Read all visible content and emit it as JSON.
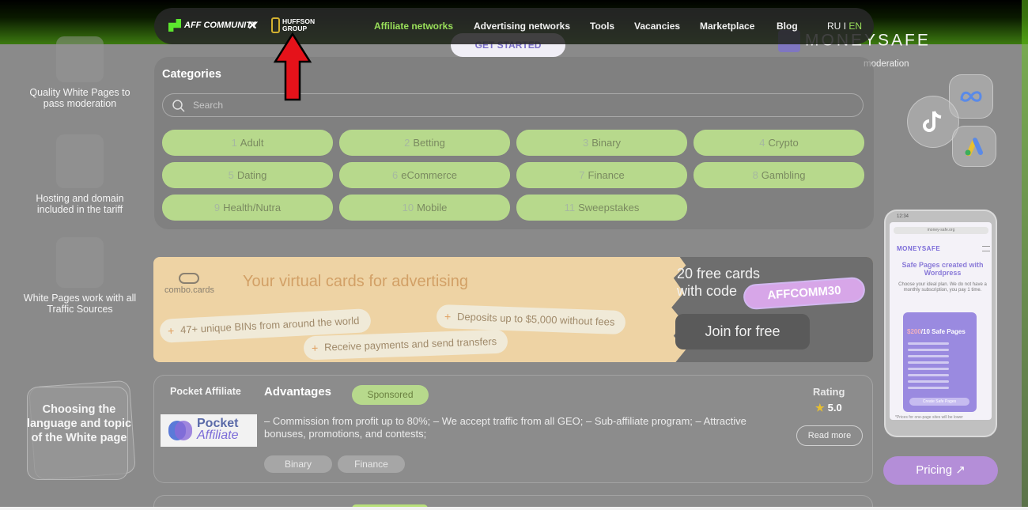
{
  "nav": {
    "brand_aff": "AFF COMMUNITY",
    "brand_x": "✕",
    "brand_huffson_line1": "HUFFSON",
    "brand_huffson_line2": "GROUP",
    "items": [
      {
        "label": "Affiliate networks",
        "active": true
      },
      {
        "label": "Advertising networks",
        "active": false
      },
      {
        "label": "Tools",
        "active": false
      },
      {
        "label": "Vacancies",
        "active": false
      },
      {
        "label": "Marketplace",
        "active": false
      },
      {
        "label": "Blog",
        "active": false
      }
    ],
    "lang_ru": "RU",
    "lang_sep": "I",
    "lang_en": "EN"
  },
  "hero": {
    "cta_partial": "GET STARTED",
    "ms_logo": "MONEYSAFE",
    "ms_sub": "moderation"
  },
  "features": [
    {
      "text": "Quality White Pages to pass moderation"
    },
    {
      "text": "Hosting and domain included in the tariff"
    },
    {
      "text": "White Pages work with all Traffic Sources"
    },
    {
      "text": "Choosing the language and topic of the White page"
    }
  ],
  "categories": {
    "title": "Categories",
    "search_placeholder": "Search",
    "items": [
      {
        "num": "1",
        "label": "Adult"
      },
      {
        "num": "2",
        "label": "Betting"
      },
      {
        "num": "3",
        "label": "Binary"
      },
      {
        "num": "4",
        "label": "Crypto"
      },
      {
        "num": "5",
        "label": "Dating"
      },
      {
        "num": "6",
        "label": "eCommerce"
      },
      {
        "num": "7",
        "label": "Finance"
      },
      {
        "num": "8",
        "label": "Gambling"
      },
      {
        "num": "9",
        "label": "Health/Nutra"
      },
      {
        "num": "10",
        "label": "Mobile"
      },
      {
        "num": "11",
        "label": "Sweepstakes"
      }
    ]
  },
  "banner": {
    "logo": "combo.cards",
    "headline": "Your virtual cards for advertising",
    "pill1": "47+ unique BINs from around the world",
    "pill2": "Deposits up to $5,000 without fees",
    "pill3": "Receive payments and send transfers",
    "free_line1": "20 free cards",
    "free_line2": "with code",
    "promo_code": "AFFCOMM30",
    "join": "Join for free"
  },
  "affiliate": {
    "name": "Pocket Affiliate",
    "logo_line1": "Pocket",
    "logo_line2": "Affiliate",
    "advantages": "Advantages",
    "badge": "Sponsored",
    "description": "– Commission from profit up to 80%; – We accept traffic from all GEO; – Sub-affiliate program; – Attractive bonuses, promotions, and contests;",
    "tags": [
      "Binary",
      "Finance"
    ],
    "rating_label": "Rating",
    "rating_value": "5.0",
    "read_more": "Read more"
  },
  "phone": {
    "time": "12:34",
    "url": "money-safe.org",
    "logo": "MONEYSAFE",
    "headline": "Safe Pages created with Wordpress",
    "sub": "Choose your ideal plan. We do not have a monthly subscription, you pay 1 time.",
    "price": "$200",
    "price_suffix": "/10 Safe Pages",
    "cta": "Create Safe Pages",
    "foot": "*Prices for one-page sites will be lower"
  },
  "pricing": "Pricing"
}
